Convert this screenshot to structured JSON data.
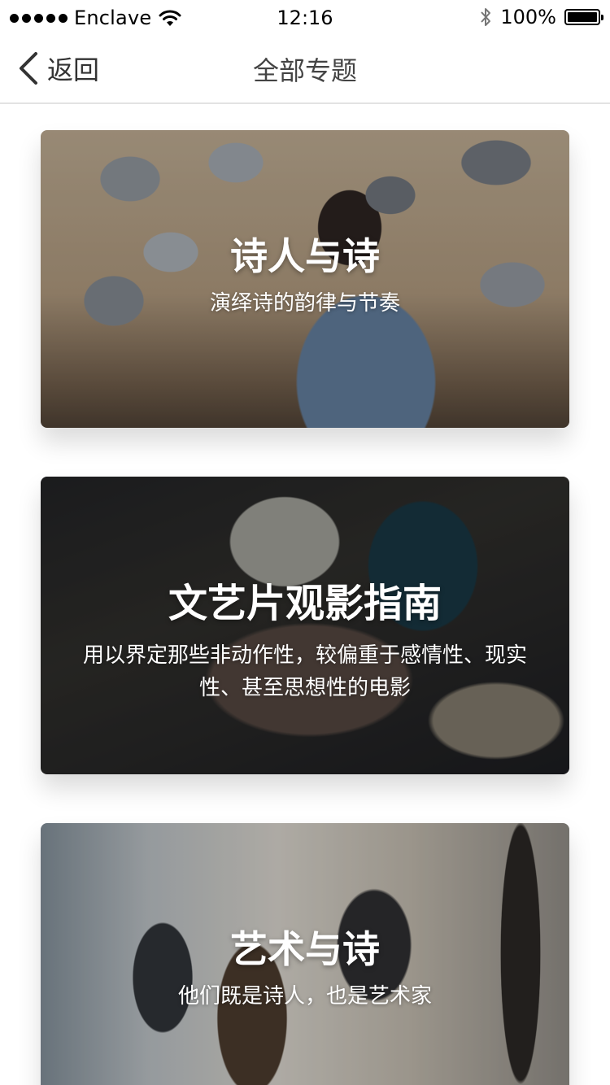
{
  "status_bar": {
    "carrier": "Enclave",
    "time": "12:16",
    "battery_text": "100%",
    "battery_level": 1.0,
    "icons": [
      "signal-dots-icon",
      "wifi-icon",
      "bluetooth-icon",
      "battery-icon"
    ]
  },
  "nav": {
    "back_label": "返回",
    "title": "全部专题",
    "back_icon": "chevron-left-icon"
  },
  "topics": [
    {
      "title": "诗人与诗",
      "subtitle": "演绎诗的韵律与节奏"
    },
    {
      "title": "文艺片观影指南",
      "subtitle": "用以界定那些非动作性，较偏重于感情性、现实性、甚至思想性的电影"
    },
    {
      "title": "艺术与诗",
      "subtitle": "他们既是诗人，也是艺术家"
    }
  ],
  "colors": {
    "nav_text": "#444444",
    "divider": "#e3e3e3",
    "card_text": "#ffffff"
  }
}
